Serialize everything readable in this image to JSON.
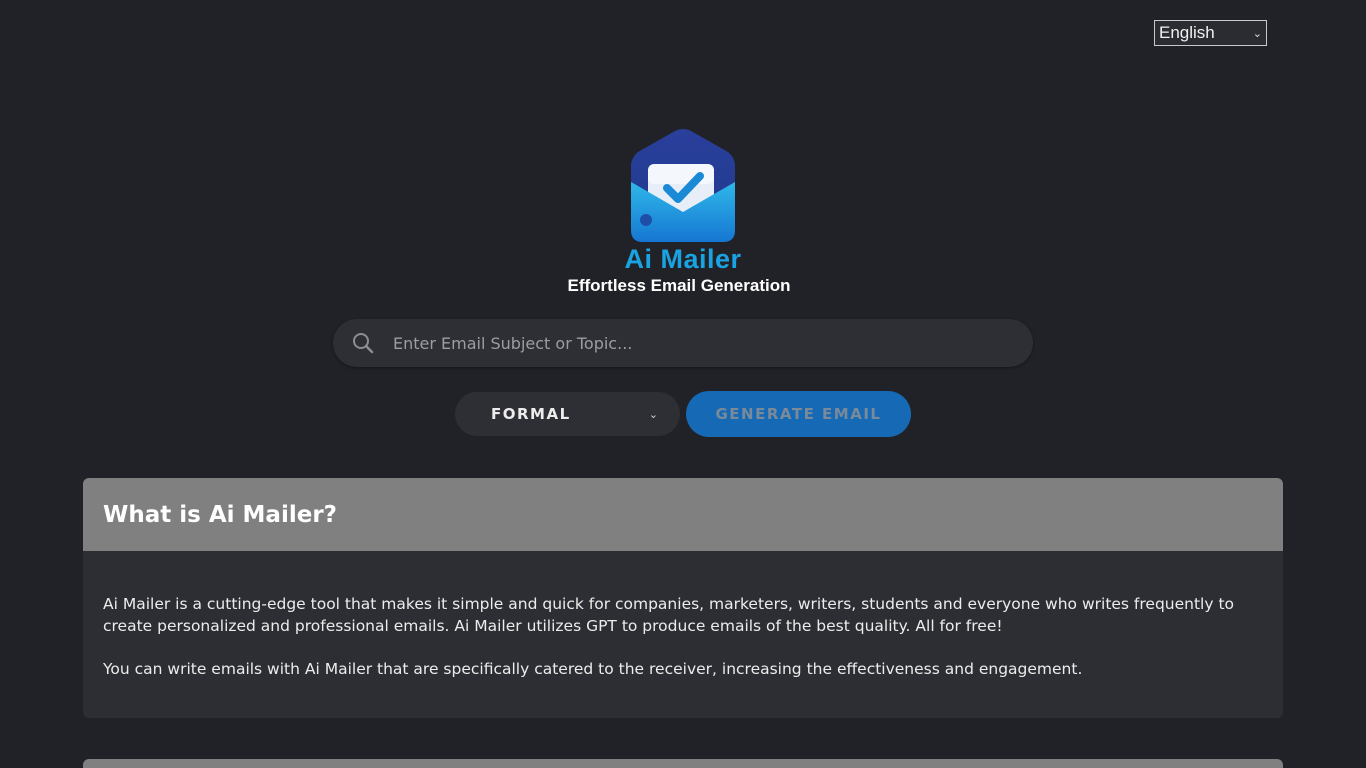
{
  "language": {
    "selected": "English"
  },
  "brand": {
    "name": "Ai Mailer",
    "tagline": "Effortless Email Generation",
    "accent_color": "#1aa3e3"
  },
  "search": {
    "placeholder": "Enter Email Subject or Topic...",
    "value": "",
    "icon": "search-icon"
  },
  "controls": {
    "tone_selected": "FORMAL",
    "generate_label": "GENERATE EMAIL",
    "generate_color": "#1669b4"
  },
  "info": {
    "title": "What is Ai Mailer?",
    "paragraphs": [
      "Ai Mailer is a cutting-edge tool that makes it simple and quick for companies, marketers, writers, students and everyone who writes frequently to create personalized and professional emails. Ai Mailer utilizes GPT to produce emails of the best quality. All for free!",
      "You can write emails with Ai Mailer that are specifically catered to the receiver, increasing the effectiveness and engagement."
    ]
  }
}
